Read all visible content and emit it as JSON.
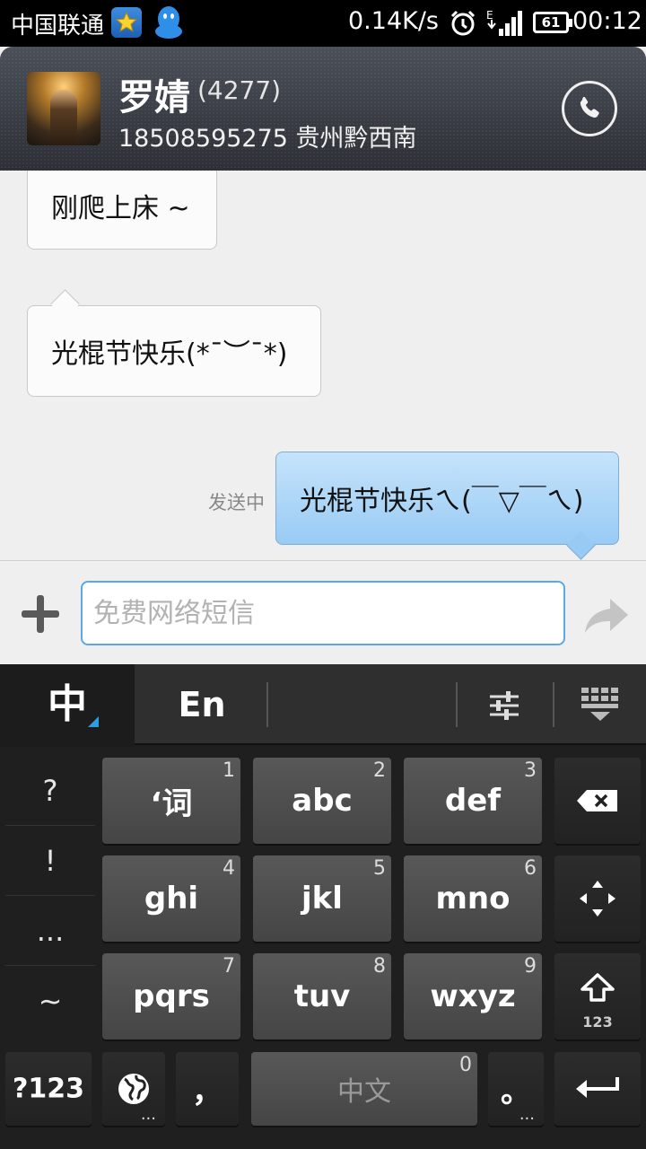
{
  "status_bar": {
    "carrier": "中国联通",
    "net_speed": "0.14K/s",
    "battery": "61",
    "time": "00:12"
  },
  "contact": {
    "name": "罗婧",
    "count": "(4277)",
    "subtitle": "18508595275 贵州黔西南"
  },
  "messages": [
    {
      "direction": "in",
      "text": "刚爬上床 ~"
    },
    {
      "direction": "in",
      "text": "光棍节快乐(*¯︶¯*)"
    },
    {
      "direction": "out",
      "text": "光棍节快乐ㄟ(￣▽￣ㄟ)",
      "status": "发送中"
    }
  ],
  "compose": {
    "placeholder": "免费网络短信",
    "value": ""
  },
  "keyboard": {
    "mode_zh": "中",
    "mode_en": "En",
    "side_symbols": [
      "?",
      "!",
      "...",
      "~"
    ],
    "keys": [
      {
        "label": "‘词",
        "num": "1"
      },
      {
        "label": "abc",
        "num": "2"
      },
      {
        "label": "def",
        "num": "3"
      },
      {
        "label": "ghi",
        "num": "4"
      },
      {
        "label": "jkl",
        "num": "5"
      },
      {
        "label": "mno",
        "num": "6"
      },
      {
        "label": "pqrs",
        "num": "7"
      },
      {
        "label": "tuv",
        "num": "8"
      },
      {
        "label": "wxyz",
        "num": "9"
      }
    ],
    "symbols_key": "?123",
    "shift_sub": "123",
    "comma": "，",
    "space_label": "中文",
    "space_num": "0",
    "period": "。",
    "globe_dots": "...",
    "period_dots": "..."
  },
  "colors": {
    "accent_blue": "#2d9de0",
    "outgoing_bubble": "#98cbf4",
    "header_bg": "#3a3d44"
  },
  "icons": [
    "star-badge-icon",
    "qq-icon",
    "alarm-icon",
    "signal-icon",
    "phone-icon",
    "plus-icon",
    "send-arrow-icon",
    "settings-sliders-icon",
    "keyboard-hide-icon",
    "backspace-icon",
    "move-cursor-icon",
    "shift-icon",
    "globe-icon",
    "enter-icon"
  ]
}
